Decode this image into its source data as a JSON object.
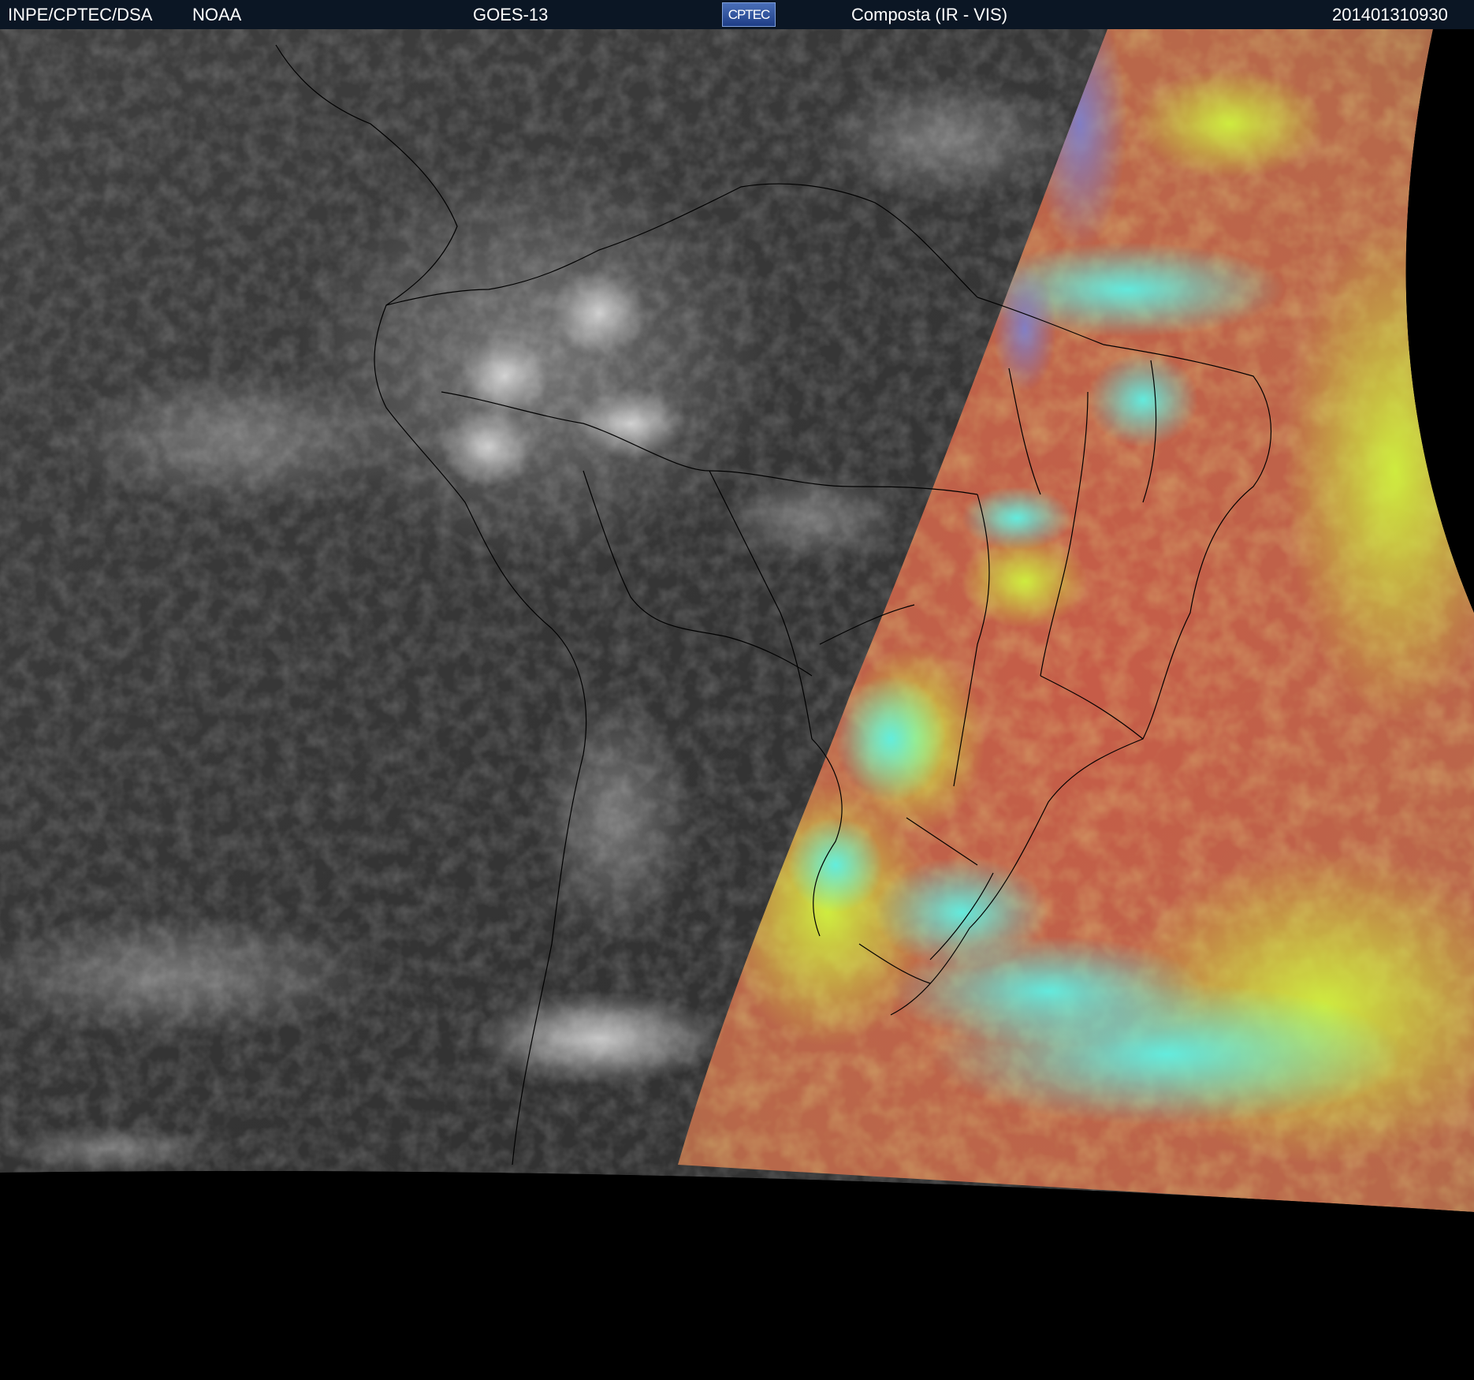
{
  "header": {
    "agency": "INPE/CPTEC/DSA",
    "source": "NOAA",
    "satellite": "GOES-13",
    "logo_text": "CPTEC",
    "product": "Composta (IR - VIS)",
    "timestamp": "201401310930"
  },
  "colors": {
    "header_background": "#0b1624",
    "header_text": "#ffffff",
    "ir_gray": "#3a3a3a",
    "vis_red": "#c0604c",
    "vis_green": "#c8f040",
    "vis_cyan": "#40e8e0",
    "space": "#000000",
    "borders": "#000000"
  }
}
